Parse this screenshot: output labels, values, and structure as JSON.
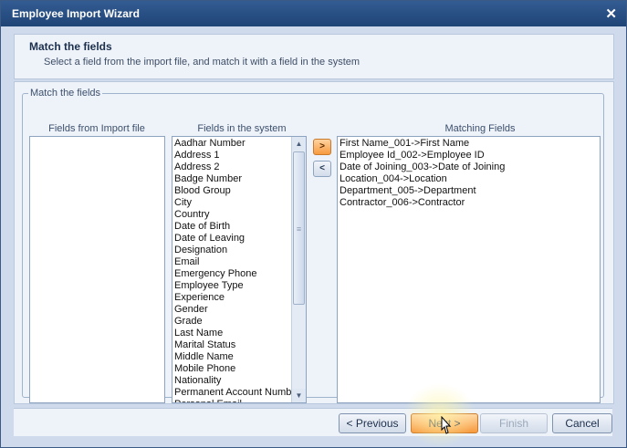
{
  "window": {
    "title": "Employee Import Wizard",
    "close_glyph": "✕"
  },
  "header": {
    "title": "Match the fields",
    "subtitle": "Select a field from the import file, and match it with a field in the system"
  },
  "group": {
    "legend": "Match the fields"
  },
  "columns": {
    "import_file": "Fields from Import file",
    "system": "Fields in the system",
    "matching": "Matching Fields"
  },
  "import_fields": [],
  "system_fields": [
    "Aadhar Number",
    "Address 1",
    "Address 2",
    "Badge Number",
    "Blood Group",
    "City",
    "Country",
    "Date of Birth",
    "Date of Leaving",
    "Designation",
    "Email",
    "Emergency Phone",
    "Employee Type",
    "Experience",
    "Gender",
    "Grade",
    "Last Name",
    "Marital Status",
    "Middle Name",
    "Mobile Phone",
    "Nationality",
    "Permanent Account Numbe",
    "Personal Email"
  ],
  "matching_fields": [
    "First Name_001->First Name",
    "Employee Id_002->Employee ID",
    "Date of Joining_003->Date of Joining",
    "Location_004->Location",
    "Department_005->Department",
    "Contractor_006->Contractor"
  ],
  "arrows": {
    "add": ">",
    "remove": "<"
  },
  "scrollbar": {
    "up": "▲",
    "down": "▼",
    "grip": "≡"
  },
  "buttons": {
    "previous": "< Previous",
    "next": "Next >",
    "finish": "Finish",
    "cancel": "Cancel"
  },
  "icons": {
    "close": "close-icon",
    "cursor": "mouse-pointer-icon"
  },
  "colors": {
    "title_bar": "#1f4476",
    "accent_orange": "#f79a3e",
    "panel": "#eef3fa"
  }
}
